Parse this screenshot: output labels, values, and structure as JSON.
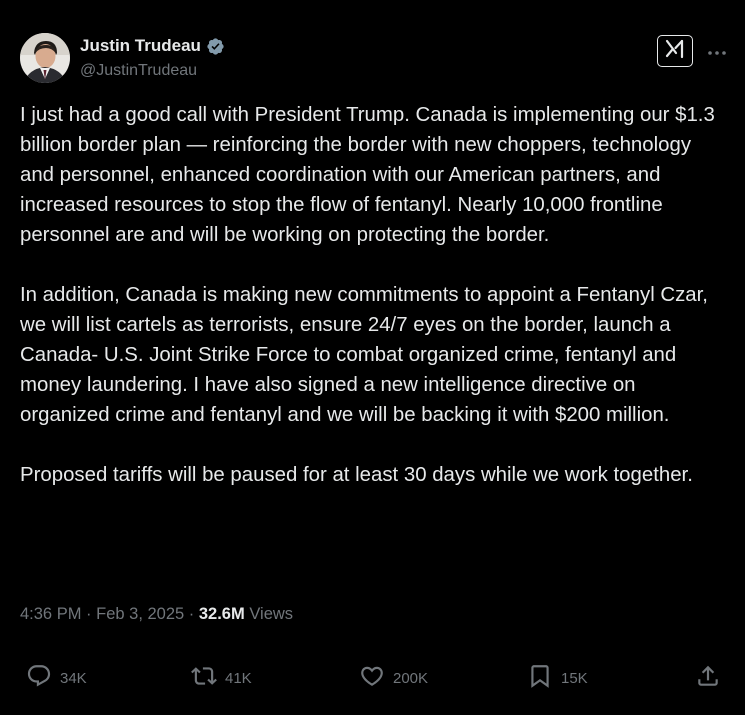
{
  "author": {
    "display_name": "Justin Trudeau",
    "handle": "@JustinTrudeau"
  },
  "tweet": {
    "paragraphs": [
      "I just had a good call with President Trump. Canada is implementing our $1.3 billion border plan — reinforcing the border with new choppers, technology and personnel, enhanced coordination with our American partners, and increased resources to stop the flow of fentanyl. Nearly 10,000 frontline personnel are and will be working on protecting the border.",
      "In addition, Canada is making new commitments to appoint a Fentanyl Czar, we will list cartels as terrorists, ensure 24/7 eyes on the border, launch a Canada- U.S. Joint Strike Force to combat organized crime, fentanyl and money laundering. I have also signed a new intelligence directive on organized crime and fentanyl and we will be backing it with $200 million.",
      "Proposed tariffs will be paused for at least 30 days while we work together."
    ],
    "time": "4:36 PM",
    "separator": " · ",
    "date": "Feb 3, 2025",
    "views_count": "32.6M",
    "views_label": "Views"
  },
  "actions": {
    "replies": "34K",
    "reposts": "41K",
    "likes": "200K",
    "bookmarks": "15K"
  },
  "icons": {
    "verified": "verified-badge-icon",
    "grok": "grok-icon",
    "more": "more-dots-icon",
    "reply": "reply-icon",
    "repost": "repost-icon",
    "like": "heart-icon",
    "bookmark": "bookmark-icon",
    "share": "share-icon"
  },
  "colors": {
    "background": "#000000",
    "text_primary": "#e7e9ea",
    "text_secondary": "#71767b",
    "verified": "#829aab"
  }
}
